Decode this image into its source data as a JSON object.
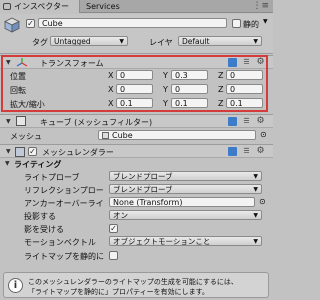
{
  "tabs": {
    "inspector": "インスペクター",
    "services": "Services"
  },
  "object": {
    "name": "Cube",
    "static_label": "静的",
    "tag_label": "タグ",
    "tag_value": "Untagged",
    "layer_label": "レイヤ",
    "layer_value": "Default"
  },
  "transform": {
    "title": "トランスフォーム",
    "rows": [
      {
        "label": "位置",
        "x": "0",
        "y": "0.3",
        "z": "0"
      },
      {
        "label": "回転",
        "x": "0",
        "y": "0",
        "z": "0"
      },
      {
        "label": "拡大/縮小",
        "x": "0.1",
        "y": "0.1",
        "z": "0.1"
      }
    ],
    "x": "X",
    "y": "Y",
    "z": "Z"
  },
  "mesh_filter": {
    "title": "キューブ (メッシュフィルター)",
    "mesh_label": "メッシュ",
    "mesh_value": "Cube"
  },
  "mesh_renderer": {
    "title": "メッシュレンダラー",
    "lighting_label": "ライティング",
    "light_probes_label": "ライトプローブ",
    "light_probes_value": "ブレンドプローブ",
    "reflection_probes_label": "リフレクションプロー",
    "reflection_probes_value": "ブレンドプローブ",
    "anchor_override_label": "アンカーオーバーライ",
    "anchor_override_value": "None (Transform)",
    "cast_shadows_label": "投影する",
    "cast_shadows_value": "オン",
    "receive_shadows_label": "影を受ける",
    "motion_vectors_label": "モーションベクトル",
    "motion_vectors_value": "オブジェクトモーションこと",
    "lightmap_static_label": "ライトマップを静的に"
  },
  "notice": {
    "line1": "このメッシュレンダラーのライトマップの生成を可能にするには、",
    "line2": "「ライトマップを静的に」プロパティーを有効にします。"
  },
  "colors": {
    "accent_red": "#d43b3b",
    "book_blue": "#3d7cc9"
  }
}
